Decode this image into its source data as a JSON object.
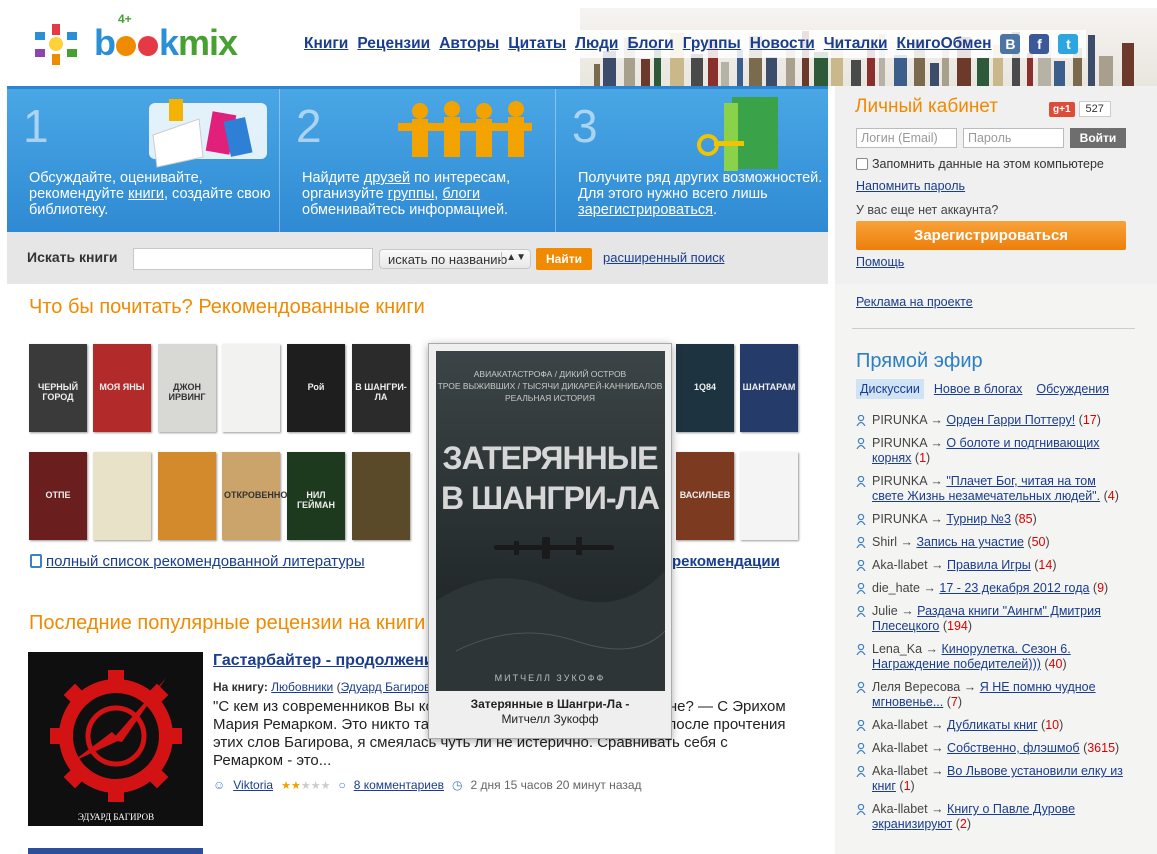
{
  "header": {
    "logo_text": "bookmix",
    "logo_age": "4+",
    "nav": [
      "Книги",
      "Рецензии",
      "Авторы",
      "Цитаты",
      "Люди",
      "Блоги",
      "Группы",
      "Новости",
      "Читалки",
      "КнигоОбмен"
    ],
    "social": [
      {
        "name": "vkontakte",
        "label": "B",
        "color": "#4c75a3"
      },
      {
        "name": "facebook",
        "label": "f",
        "color": "#3b5998"
      },
      {
        "name": "twitter",
        "label": "t",
        "color": "#2ba6e1"
      }
    ]
  },
  "promo": [
    {
      "num": "1",
      "pre": "Обсуждайте, оценивайте, рекомендуйте ",
      "link1": "книги",
      "mid": ", создайте свою библиотеку.",
      "link2": "",
      "post": ""
    },
    {
      "num": "2",
      "pre": "Найдите ",
      "link1": "друзей",
      "mid": " по интересам, организуйте ",
      "link2": "группы",
      "sep": ", ",
      "link3": "блоги",
      "post": " обменивайтесь информацией."
    },
    {
      "num": "3",
      "pre": "Получите ряд других возможностей. Для этого нужно всего лишь ",
      "link1": "зарегистрироваться",
      "post": "."
    }
  ],
  "search": {
    "label": "Искать книги",
    "input_value": "",
    "select_value": "искать по названию",
    "button": "Найти",
    "advanced": "расширенный поиск"
  },
  "recommended": {
    "title": "Что бы почитать? Рекомендованные книги",
    "full_list_link": "полный список рекомендованной литературы",
    "reco_link": "рекомендации",
    "covers_row1": [
      {
        "color": "#3a3a3a",
        "text": "ЧЕРНЫЙ ГОРОД"
      },
      {
        "color": "#b22a2a",
        "text": "МОЯ ЯНЫ"
      },
      {
        "color": "#d8d8d4",
        "text": "ДЖОН ИРВИНГ"
      },
      {
        "color": "#f2f2f0",
        "text": ""
      },
      {
        "color": "#1e1e1e",
        "text": "Рой"
      },
      {
        "color": "#2b2b2b",
        "text": "В ШАНГРИ-ЛА"
      },
      {
        "color": "#1d3340",
        "text": "1Q84"
      },
      {
        "color": "#253b6a",
        "text": "ШАНТАРАМ"
      }
    ],
    "covers_row2": [
      {
        "color": "#6a1e1e",
        "text": "ОТПЕ"
      },
      {
        "color": "#e8e2c8",
        "text": ""
      },
      {
        "color": "#d28a2c",
        "text": ""
      },
      {
        "color": "#caa46a",
        "text": "ОТКРОВЕННО"
      },
      {
        "color": "#1e3a1e",
        "text": "НИЛ ГЕЙМАН"
      },
      {
        "color": "#5b4a2a",
        "text": ""
      },
      {
        "color": "#7c3a20",
        "text": "ВАСИЛЬЕВ"
      },
      {
        "color": "#f4f4f4",
        "text": ""
      }
    ]
  },
  "popup": {
    "cover_lines": [
      "АВИАКАТАСТРОФА / ДИКИЙ ОСТРОВ",
      "ТРОЕ ВЫЖИВШИХ / ТЫСЯЧИ ДИКАРЕЙ-КАННИБАЛОВ",
      "РЕАЛЬНАЯ ИСТОРИЯ"
    ],
    "cover_title": "ЗАТЕРЯННЫЕ В ШАНГРИ-ЛА",
    "cover_author": "МИТЧЕЛЛ ЗУКОФФ",
    "caption_title": "Затерянные в Шангри-Ла -",
    "caption_author": "Митчелл Зукофф"
  },
  "reviews": {
    "title": "Последние популярные рецензии на книги",
    "item": {
      "cover_author": "ЭДУАРД БАГИРОВ",
      "title": "Гастарбайтер - продолжение",
      "book_label": "На книгу:",
      "book_title": "Любовники",
      "book_author": "Эдуард Багиров",
      "text": "\"С кем из современников Вы которые говорят о том в другом плане? — С Эрихом Мария Ремарком. Это никто так не понимает, о чем и я.\" Знаете, после прочтения этих слов Багирова, я смеялась чуть ли не истерично. Сравнивать себя с Ремарком - это...",
      "user": "Viktoria",
      "rating": 2,
      "rating_max": 5,
      "comments": "8 комментариев",
      "time": "2 дня 15 часов 20 минут назад"
    }
  },
  "sidebar": {
    "cabinet_title": "Личный кабинет",
    "gplus_label": "+1",
    "gplus_count": "527",
    "login_placeholder": "Логин (Email)",
    "password_placeholder": "Пароль",
    "login_button": "Войти",
    "remember": "Запомнить данные на этом компьютере",
    "forgot": "Напомнить пароль",
    "no_account": "У вас еще нет аккаунта?",
    "register": "Зарегистрироваться",
    "help": "Помощь",
    "ad": "Реклама на проекте",
    "live_title": "Прямой эфир",
    "tabs": [
      "Дискуссии",
      "Новое в блогах",
      "Обсуждения"
    ],
    "feed": [
      {
        "user": "PIRUNKA",
        "topic": "Орден Гарри Поттеру!",
        "count": "17"
      },
      {
        "user": "PIRUNKA",
        "topic": "О болоте и подгнивающих корнях",
        "count": "1"
      },
      {
        "user": "PIRUNKA",
        "topic": "\"Плачет Бог, читая на том свете Жизнь незамечательных людей\".",
        "count": "4"
      },
      {
        "user": "PIRUNKA",
        "topic": "Турнир №3",
        "count": "85"
      },
      {
        "user": "Shirl",
        "topic": "Запись на участие",
        "count": "50"
      },
      {
        "user": "Aka-llabet",
        "topic": "Правила Игры",
        "count": "14"
      },
      {
        "user": "die_hate",
        "topic": "17 - 23 декабря 2012 года",
        "count": "9"
      },
      {
        "user": "Julie",
        "topic": "Раздача книги \"Аингм\" Дмитрия Плесецкого",
        "count": "194"
      },
      {
        "user": "Lena_Ka",
        "topic": "Кинорулетка. Сезон 6. Награждение победителей)))",
        "count": "40"
      },
      {
        "user": "Леля Вересова",
        "topic": "Я НЕ помню чудное мгновенье...",
        "count": "7"
      },
      {
        "user": "Aka-llabet",
        "topic": "Дубликаты книг",
        "count": "10"
      },
      {
        "user": "Aka-llabet",
        "topic": "Собственно, флэшмоб",
        "count": "3615"
      },
      {
        "user": "Aka-llabet",
        "topic": "Во Львове установили елку из книг",
        "count": "1"
      },
      {
        "user": "Aka-llabet",
        "topic": "Книгу о Павле Дурове экранизируют",
        "count": "2"
      }
    ]
  },
  "colors": {
    "accent": "#f08a00",
    "link": "#1a3d8f",
    "promo_blue": "#3a96dc"
  }
}
